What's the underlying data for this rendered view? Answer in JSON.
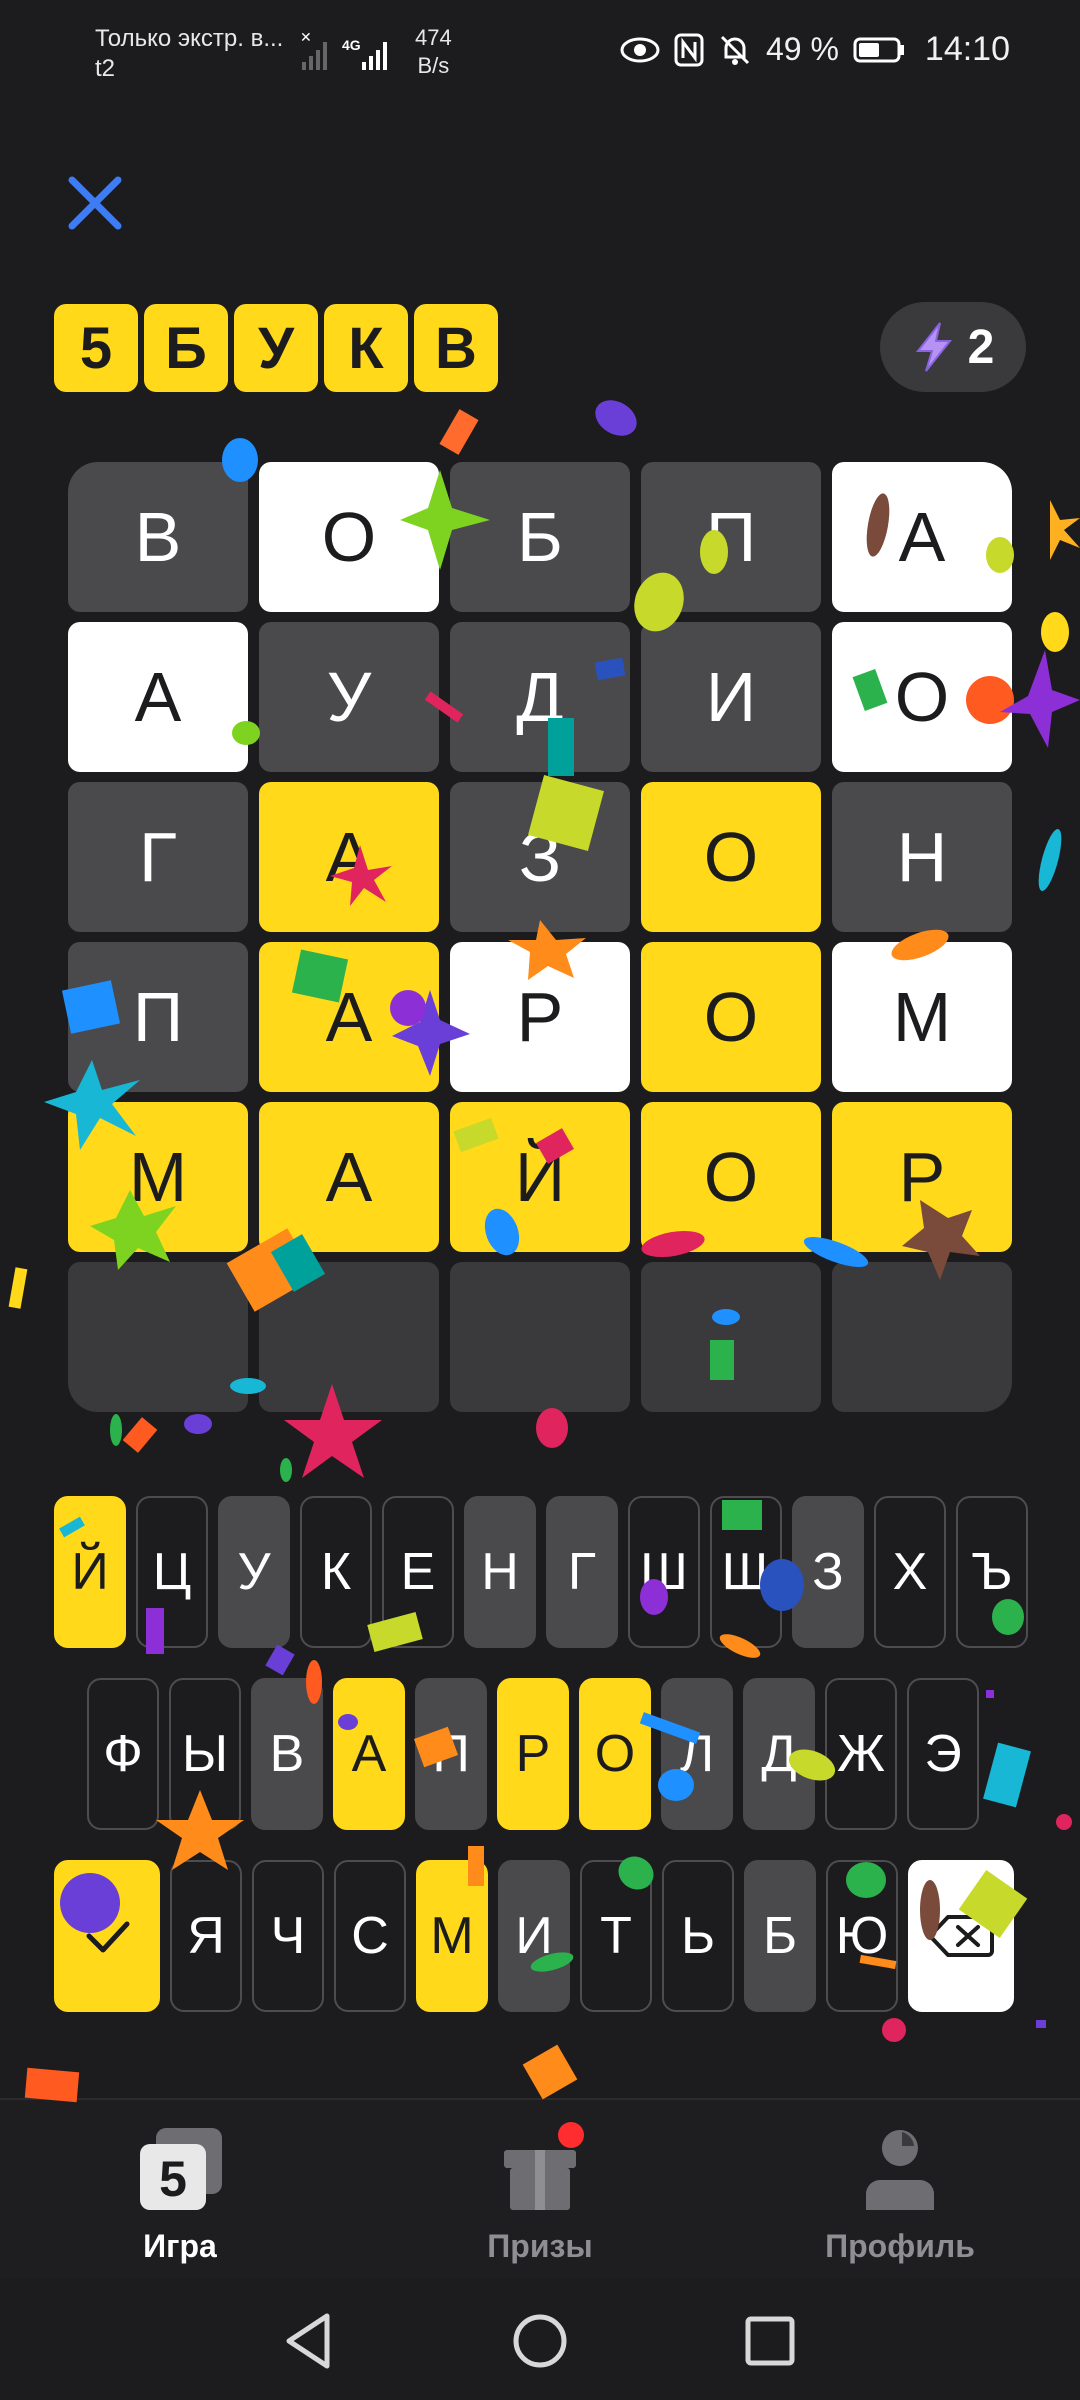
{
  "status_bar": {
    "carrier_line1": "Только экстр. в...",
    "carrier_line2": "t2",
    "network": "4G",
    "speed_value": "474",
    "speed_unit": "B/s",
    "battery": "49 %",
    "time": "14:10"
  },
  "header": {
    "logo_letters": [
      "5",
      "Б",
      "У",
      "К",
      "В"
    ],
    "hints_count": "2"
  },
  "board": {
    "rows": [
      [
        {
          "letter": "В",
          "state": "absent"
        },
        {
          "letter": "О",
          "state": "present"
        },
        {
          "letter": "Б",
          "state": "absent"
        },
        {
          "letter": "П",
          "state": "absent"
        },
        {
          "letter": "А",
          "state": "present"
        }
      ],
      [
        {
          "letter": "А",
          "state": "present"
        },
        {
          "letter": "У",
          "state": "absent"
        },
        {
          "letter": "Д",
          "state": "absent"
        },
        {
          "letter": "И",
          "state": "absent"
        },
        {
          "letter": "О",
          "state": "present"
        }
      ],
      [
        {
          "letter": "Г",
          "state": "absent"
        },
        {
          "letter": "А",
          "state": "correct"
        },
        {
          "letter": "З",
          "state": "absent"
        },
        {
          "letter": "О",
          "state": "correct"
        },
        {
          "letter": "Н",
          "state": "absent"
        }
      ],
      [
        {
          "letter": "П",
          "state": "absent"
        },
        {
          "letter": "А",
          "state": "correct"
        },
        {
          "letter": "Р",
          "state": "present"
        },
        {
          "letter": "О",
          "state": "correct"
        },
        {
          "letter": "М",
          "state": "present"
        }
      ],
      [
        {
          "letter": "М",
          "state": "correct"
        },
        {
          "letter": "А",
          "state": "correct"
        },
        {
          "letter": "Й",
          "state": "correct"
        },
        {
          "letter": "О",
          "state": "correct"
        },
        {
          "letter": "Р",
          "state": "correct"
        }
      ],
      [
        {
          "letter": "",
          "state": "empty"
        },
        {
          "letter": "",
          "state": "empty"
        },
        {
          "letter": "",
          "state": "empty"
        },
        {
          "letter": "",
          "state": "empty"
        },
        {
          "letter": "",
          "state": "empty"
        }
      ]
    ]
  },
  "keyboard": {
    "row1": [
      {
        "key": "Й",
        "state": "correct"
      },
      {
        "key": "Ц",
        "state": "unused"
      },
      {
        "key": "У",
        "state": "absent"
      },
      {
        "key": "К",
        "state": "unused"
      },
      {
        "key": "Е",
        "state": "unused"
      },
      {
        "key": "Н",
        "state": "absent"
      },
      {
        "key": "Г",
        "state": "absent"
      },
      {
        "key": "Ш",
        "state": "unused"
      },
      {
        "key": "Щ",
        "state": "unused"
      },
      {
        "key": "З",
        "state": "absent"
      },
      {
        "key": "Х",
        "state": "unused"
      },
      {
        "key": "Ъ",
        "state": "unused"
      }
    ],
    "row2": [
      {
        "key": "Ф",
        "state": "unused"
      },
      {
        "key": "Ы",
        "state": "unused"
      },
      {
        "key": "В",
        "state": "absent"
      },
      {
        "key": "А",
        "state": "correct"
      },
      {
        "key": "П",
        "state": "absent"
      },
      {
        "key": "Р",
        "state": "correct"
      },
      {
        "key": "О",
        "state": "correct"
      },
      {
        "key": "Л",
        "state": "absent"
      },
      {
        "key": "Д",
        "state": "absent"
      },
      {
        "key": "Ж",
        "state": "unused"
      },
      {
        "key": "Э",
        "state": "unused"
      }
    ],
    "row3": [
      {
        "key": "Я",
        "state": "unused"
      },
      {
        "key": "Ч",
        "state": "unused"
      },
      {
        "key": "С",
        "state": "unused"
      },
      {
        "key": "М",
        "state": "correct"
      },
      {
        "key": "И",
        "state": "absent"
      },
      {
        "key": "Т",
        "state": "unused"
      },
      {
        "key": "Ь",
        "state": "unused"
      },
      {
        "key": "Б",
        "state": "absent"
      },
      {
        "key": "Ю",
        "state": "unused"
      }
    ],
    "enter_icon": "checkmark-icon",
    "backspace_icon": "backspace-icon"
  },
  "bottom_nav": {
    "items": [
      {
        "label": "Игра",
        "icon": "game-5-icon",
        "active": true
      },
      {
        "label": "Призы",
        "icon": "gift-icon",
        "active": false,
        "badge": true
      },
      {
        "label": "Профиль",
        "icon": "profile-icon",
        "active": false
      }
    ]
  },
  "colors": {
    "background": "#1c1c1e",
    "correct": "#ffd91a",
    "present": "#ffffff",
    "absent": "#4a4a4c",
    "accent_close": "#3d7cf5",
    "badge": "#ff2d2d"
  }
}
